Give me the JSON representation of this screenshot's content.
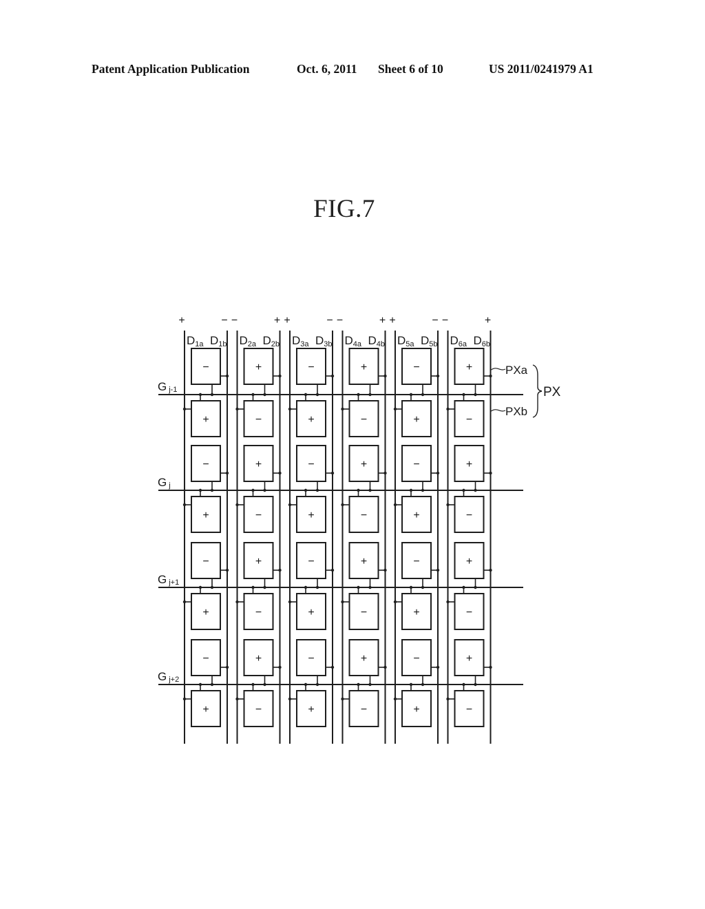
{
  "header": {
    "publication": "Patent Application Publication",
    "date": "Oct. 6, 2011",
    "sheet": "Sheet 6 of 10",
    "patent_number": "US 2011/0241979 A1"
  },
  "figure": {
    "title": "FIG.7",
    "data_lines": [
      {
        "a": {
          "label": "D",
          "sub": "1a",
          "polarity": "+"
        },
        "b": {
          "label": "D",
          "sub": "1b",
          "polarity": "−"
        }
      },
      {
        "a": {
          "label": "D",
          "sub": "2a",
          "polarity": "−"
        },
        "b": {
          "label": "D",
          "sub": "2b",
          "polarity": "+"
        }
      },
      {
        "a": {
          "label": "D",
          "sub": "3a",
          "polarity": "+"
        },
        "b": {
          "label": "D",
          "sub": "3b",
          "polarity": "−"
        }
      },
      {
        "a": {
          "label": "D",
          "sub": "4a",
          "polarity": "−"
        },
        "b": {
          "label": "D",
          "sub": "4b",
          "polarity": "+"
        }
      },
      {
        "a": {
          "label": "D",
          "sub": "5a",
          "polarity": "+"
        },
        "b": {
          "label": "D",
          "sub": "5b",
          "polarity": "−"
        }
      },
      {
        "a": {
          "label": "D",
          "sub": "6a",
          "polarity": "−"
        },
        "b": {
          "label": "D",
          "sub": "6b",
          "polarity": "+"
        }
      }
    ],
    "gate_lines": [
      {
        "label": "G",
        "sub": "j-1"
      },
      {
        "label": "G",
        "sub": "j"
      },
      {
        "label": "G",
        "sub": "j+1"
      },
      {
        "label": "G",
        "sub": "j+2"
      }
    ],
    "pixel_polarities": [
      [
        "−",
        "+",
        "−",
        "+",
        "−",
        "+"
      ],
      [
        "+",
        "−",
        "+",
        "−",
        "+",
        "−"
      ],
      [
        "−",
        "+",
        "−",
        "+",
        "−",
        "+"
      ],
      [
        "+",
        "−",
        "+",
        "−",
        "+",
        "−"
      ],
      [
        "−",
        "+",
        "−",
        "+",
        "−",
        "+"
      ],
      [
        "+",
        "−",
        "+",
        "−",
        "+",
        "−"
      ],
      [
        "−",
        "+",
        "−",
        "+",
        "−",
        "+"
      ],
      [
        "+",
        "−",
        "+",
        "−",
        "+",
        "−"
      ]
    ],
    "callouts": {
      "pxa": "PXa",
      "pxb": "PXb",
      "px": "PX"
    }
  }
}
